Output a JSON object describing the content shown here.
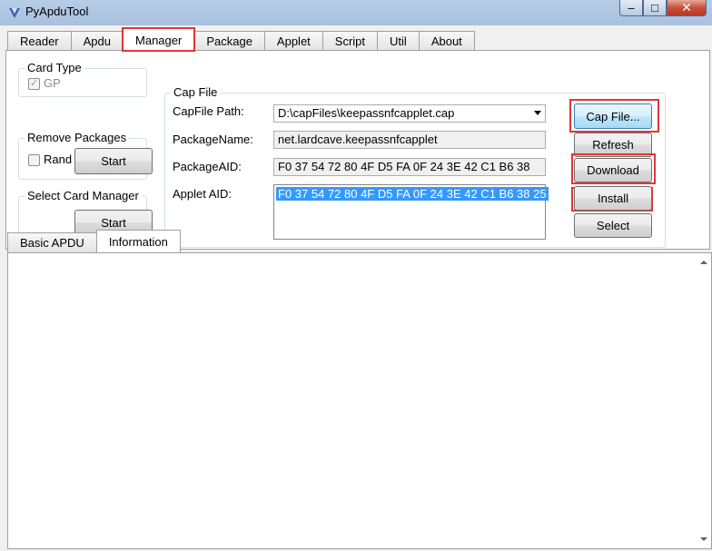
{
  "window": {
    "title": "PyApduTool",
    "minimize_glyph": "–",
    "maximize_glyph": "□",
    "close_glyph": "✕"
  },
  "tabs": [
    "Reader",
    "Apdu",
    "Manager",
    "Package",
    "Applet",
    "Script",
    "Util",
    "About"
  ],
  "active_tab": "Manager",
  "card_type": {
    "title": "Card Type",
    "gp_label": "GP",
    "gp_checked": true
  },
  "remove_packages": {
    "title": "Remove Packages",
    "rand_label": "Rand",
    "start_label": "Start"
  },
  "select_card_manager": {
    "title": "Select Card Manager",
    "start_label": "Start"
  },
  "cap_file": {
    "title": "Cap File",
    "path_label": "CapFile Path:",
    "path_value": "D:\\capFiles\\keepassnfcapplet.cap",
    "package_name_label": "PackageName:",
    "package_name_value": "net.lardcave.keepassnfcapplet",
    "package_aid_label": "PackageAID:",
    "package_aid_value": "F0 37 54 72 80 4F D5 FA 0F 24 3E 42 C1 B6 38",
    "applet_aid_label": "Applet AID:",
    "applet_aid_value": "F0 37 54 72 80 4F D5 FA 0F 24 3E 42 C1 B6 38 25"
  },
  "actions": {
    "cap_file": "Cap File...",
    "refresh": "Refresh",
    "download": "Download",
    "install": "Install",
    "select": "Select"
  },
  "bottom_tabs": [
    "Basic APDU",
    "Information"
  ],
  "active_bottom_tab": "Information",
  "colors": {
    "highlight_border": "#e0363b",
    "selection": "#3399ff"
  }
}
